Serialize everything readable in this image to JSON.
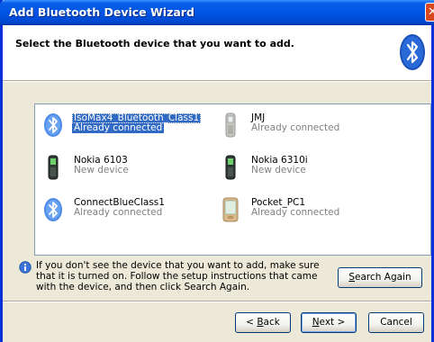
{
  "window": {
    "title": "Add Bluetooth Device Wizard",
    "close_glyph": "✕"
  },
  "header": {
    "title": "Select the Bluetooth device that you want to add.",
    "icon": "bluetooth-logo"
  },
  "devices": [
    {
      "name": "IsoMax4_Bluetooth_Class1",
      "status": "Already connected",
      "icon": "bluetooth-icon",
      "selected": true
    },
    {
      "name": "JMJ",
      "status": "Already connected",
      "icon": "phone-icon",
      "selected": false
    },
    {
      "name": "Nokia 6103",
      "status": "New device",
      "icon": "phone-icon",
      "selected": false
    },
    {
      "name": "Nokia 6310i",
      "status": "New device",
      "icon": "phone-icon",
      "selected": false
    },
    {
      "name": "ConnectBlueClass1",
      "status": "Already connected",
      "icon": "bluetooth-icon",
      "selected": false
    },
    {
      "name": "Pocket_PC1",
      "status": "Already connected",
      "icon": "pda-icon",
      "selected": false
    }
  ],
  "hint": {
    "text": "If you don't see the device that you want to add, make sure that it is turned on. Follow the setup instructions that came with the device, and then click Search Again.",
    "icon": "info-icon"
  },
  "buttons": {
    "search_again": {
      "mnemonic": "S",
      "rest": "earch Again"
    },
    "back": {
      "prefix": "< ",
      "mnemonic": "B",
      "rest": "ack"
    },
    "next": {
      "mnemonic": "N",
      "rest": "ext >"
    },
    "cancel": {
      "label": "Cancel"
    }
  },
  "colors": {
    "titlebar": "#0054e3",
    "selection": "#316ac5",
    "close": "#d8471f"
  }
}
